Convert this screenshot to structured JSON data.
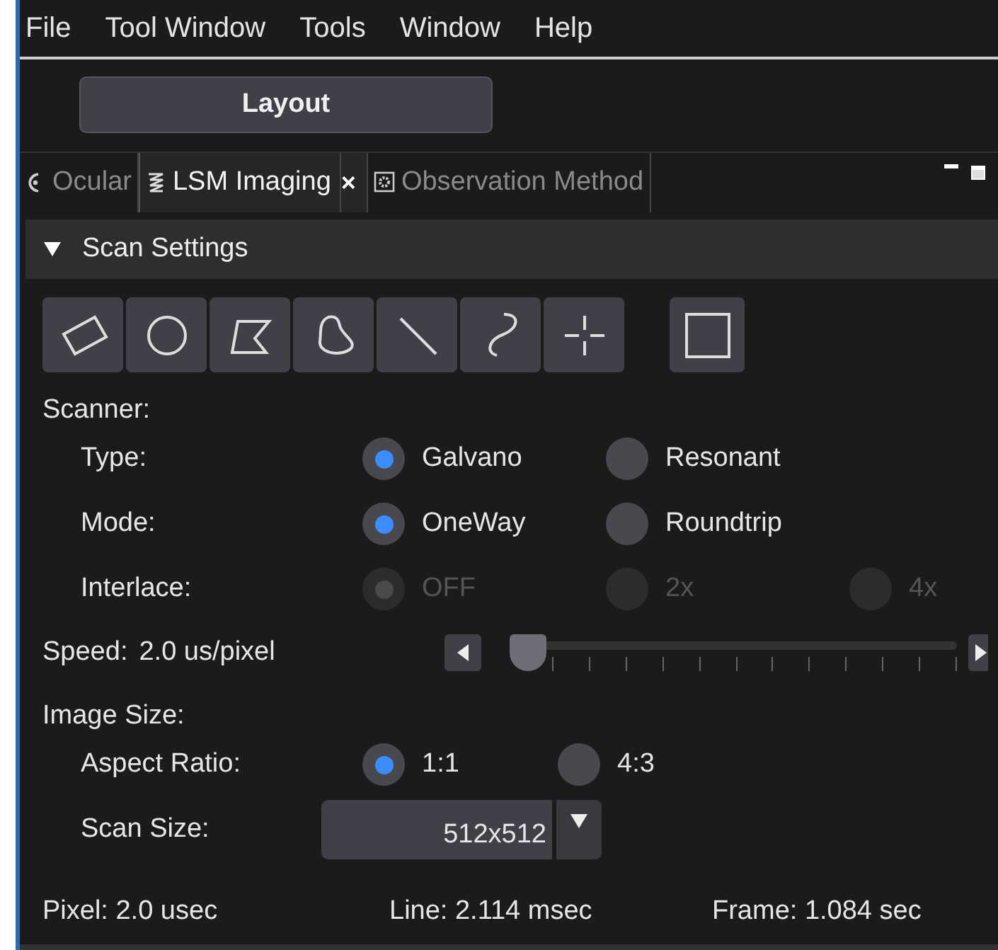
{
  "menu_bar": [
    "File",
    "Tool Window",
    "Tools",
    "Window",
    "Help"
  ],
  "layout_button": "Layout",
  "tabs": [
    {
      "label": "Ocular",
      "kind": "eye",
      "selected": false
    },
    {
      "label": "LSM Imaging",
      "kind": "scan",
      "selected": true,
      "close": "×"
    },
    {
      "label": "Observation Method",
      "kind": "gear",
      "selected": false
    }
  ],
  "section": {
    "title": "Scan Settings",
    "expanded": true
  },
  "tools": [
    {
      "kind": "rotated-rect"
    },
    {
      "kind": "circle"
    },
    {
      "kind": "polygon"
    },
    {
      "kind": "freehand"
    },
    {
      "kind": "line"
    },
    {
      "kind": "curve"
    },
    {
      "kind": "point"
    },
    {
      "kind": "square"
    }
  ],
  "scanner": {
    "heading": "Scanner:",
    "rows": [
      {
        "label": "Type:",
        "disabled": false,
        "options": [
          {
            "label": "Galvano",
            "selected": true
          },
          {
            "label": "Resonant",
            "selected": false
          }
        ]
      },
      {
        "label": "Mode:",
        "disabled": false,
        "options": [
          {
            "label": "OneWay",
            "selected": true
          },
          {
            "label": "Roundtrip",
            "selected": false
          }
        ]
      },
      {
        "label": "Interlace:",
        "disabled": true,
        "options": [
          {
            "label": "OFF",
            "selected": true
          },
          {
            "label": "2x",
            "selected": false
          },
          {
            "label": "4x",
            "selected": false
          }
        ]
      }
    ]
  },
  "speed": {
    "label": "Speed:",
    "reading": "2.0 us/pixel",
    "level": 0
  },
  "image_size": {
    "heading": "Image Size:",
    "aspect": {
      "label": "Aspect Ratio:",
      "options": [
        {
          "label": "1:1",
          "selected": true
        },
        {
          "label": "4:3",
          "selected": false
        }
      ]
    },
    "scan_size": {
      "label": "Scan Size:",
      "value": "512x512"
    }
  },
  "status": [
    "Pixel: 2.0 usec",
    "Line: 2.114 msec",
    "Frame: 1.084 sec"
  ]
}
